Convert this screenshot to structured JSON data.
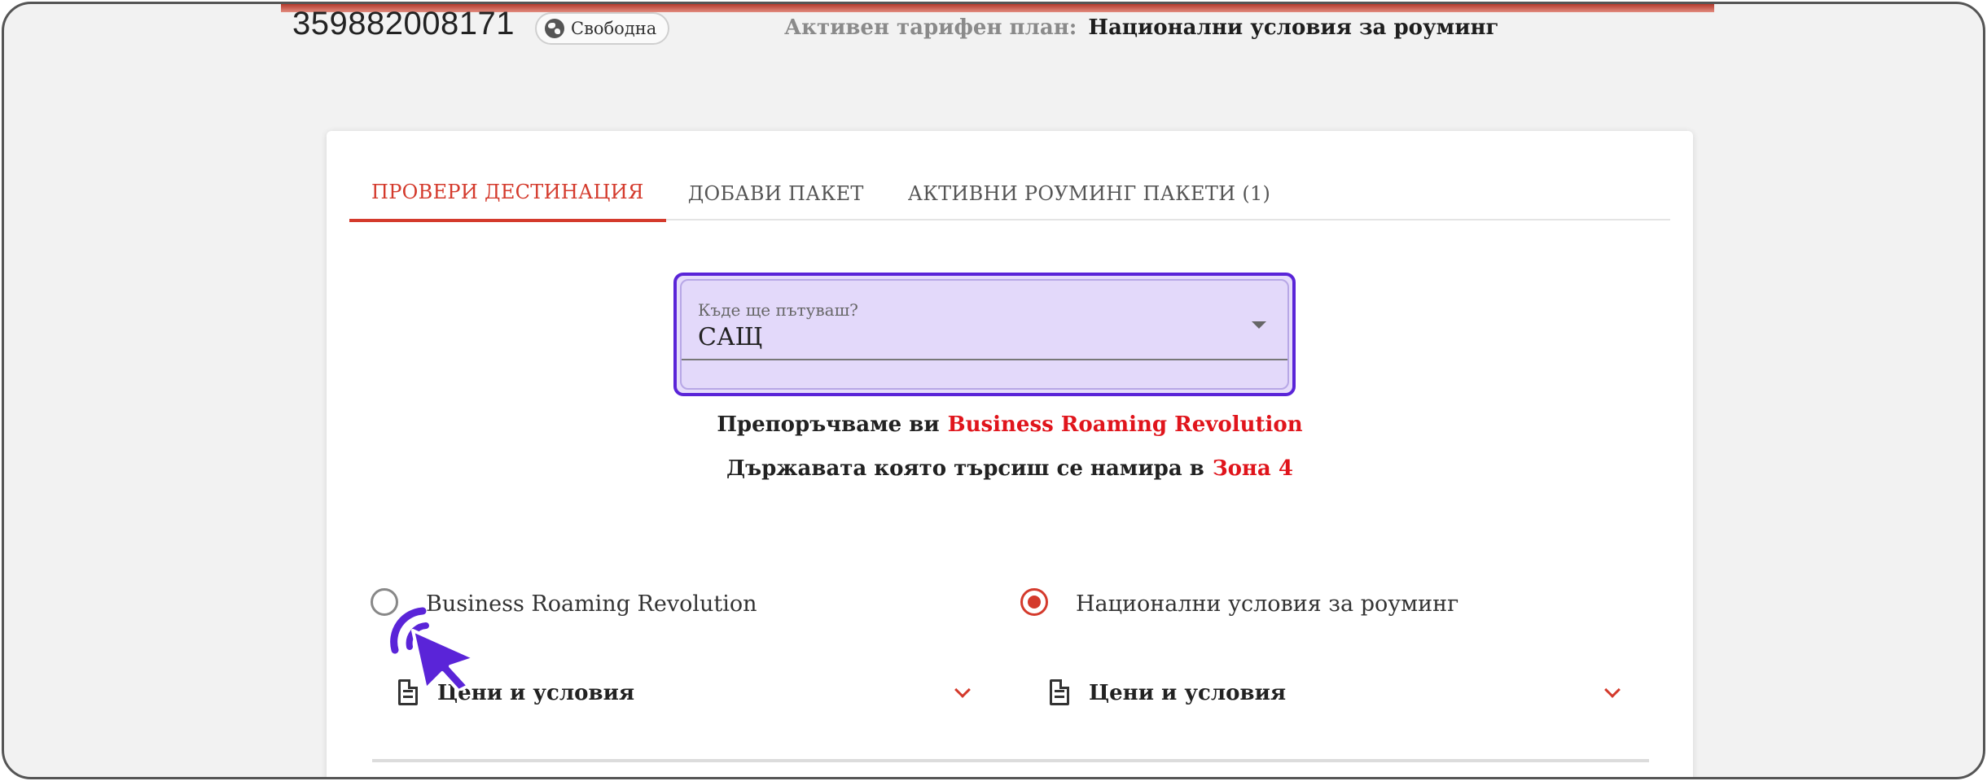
{
  "header": {
    "phone_number": "359882008171",
    "status_chip": "Свободна",
    "plan_label": "Активен тарифен план:",
    "plan_value": "Национални условия за роуминг"
  },
  "tabs": [
    {
      "label": "ПРОВЕРИ ДЕСТИНАЦИЯ",
      "active": true
    },
    {
      "label": "ДОБАВИ ПАКЕТ",
      "active": false
    },
    {
      "label": "АКТИВНИ РОУМИНГ ПАКЕТИ (1)",
      "active": false
    }
  ],
  "destination": {
    "label": "Къде ще пътуваш?",
    "value": "САЩ"
  },
  "recommendation": {
    "prefix": "Препоръчваме ви",
    "value": "Business Roaming Revolution"
  },
  "zone": {
    "prefix": "Държавата която търсиш се намира в",
    "value": "Зона 4"
  },
  "options": [
    {
      "label": "Business Roaming Revolution",
      "selected": false,
      "terms_label": "Цени и условия"
    },
    {
      "label": "Национални условия за роуминг",
      "selected": true,
      "terms_label": "Цени и условия"
    }
  ],
  "icons": {
    "status": "globe-icon",
    "dropdown": "caret-down-icon",
    "terms": "document-icon",
    "expand": "chevron-down-icon",
    "pointer": "click-cursor-icon"
  },
  "colors": {
    "accent": "#d43a2c",
    "highlight": "#e0151c",
    "focus": "#5a24d8"
  }
}
